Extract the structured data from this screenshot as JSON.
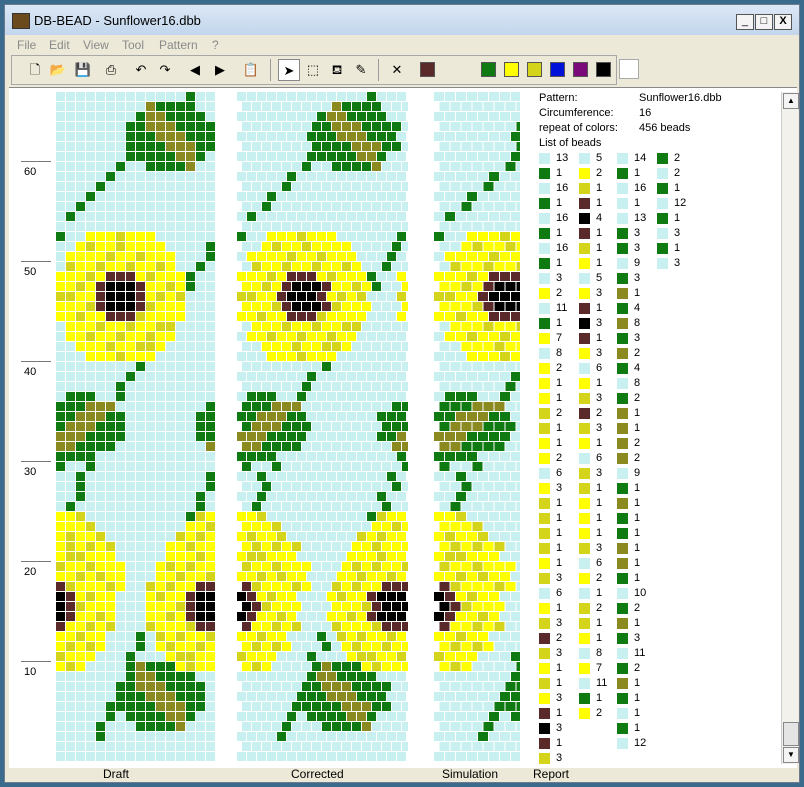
{
  "window": {
    "title": "DB-BEAD - Sunflower16.dbb",
    "buttons": {
      "minimize": "_",
      "maximize": "□",
      "close": "X"
    }
  },
  "menu": [
    "File",
    "Edit",
    "View",
    "Tool",
    "Pattern",
    "?"
  ],
  "toolbar": {
    "icons": [
      "new-icon",
      "open-icon",
      "save-icon",
      "print-icon",
      "undo-icon",
      "redo-icon",
      "arrow-left-icon",
      "arrow-right-icon",
      "paste-icon",
      "pointer-icon",
      "select-icon",
      "fill-icon",
      "pipette-icon",
      "delete-icon"
    ],
    "colors": [
      "#5a2a2a",
      "#0f7a12",
      "#ffff00",
      "#d4d41a",
      "#0012d8",
      "#7a0a7a",
      "#000000",
      "#ffffff"
    ]
  },
  "ruler": [
    "60",
    "50",
    "40",
    "30",
    "20",
    "10"
  ],
  "panel_labels": [
    "Draft",
    "Corrected",
    "Simulation",
    "Report"
  ],
  "report": {
    "pattern_label": "Pattern:",
    "pattern_value": "Sunflower16.dbb",
    "circ_label": "Circumference:",
    "circ_value": "16",
    "repeat_label": "repeat of colors:",
    "repeat_value": "456 beads",
    "list_label": "List of beads",
    "colors": {
      "L": "#c8f0f0",
      "G": "#0f7a12",
      "Y": "#ffff00",
      "K": "#d4d41a",
      "O": "#8a8a20",
      "B": "#5a2a2a",
      "X": "#000000"
    },
    "columns": [
      [
        [
          "L",
          "13"
        ],
        [
          "G",
          "1"
        ],
        [
          "L",
          "16"
        ],
        [
          "G",
          "1"
        ],
        [
          "L",
          "16"
        ],
        [
          "G",
          "1"
        ],
        [
          "L",
          "16"
        ],
        [
          "G",
          "1"
        ],
        [
          "L",
          "3"
        ],
        [
          "Y",
          "2"
        ],
        [
          "L",
          "11"
        ],
        [
          "G",
          "1"
        ],
        [
          "Y",
          "7"
        ],
        [
          "L",
          "8"
        ],
        [
          "Y",
          "2"
        ],
        [
          "Y",
          "1"
        ],
        [
          "Y",
          "1"
        ],
        [
          "K",
          "2"
        ],
        [
          "K",
          "1"
        ],
        [
          "Y",
          "1"
        ],
        [
          "Y",
          "2"
        ],
        [
          "L",
          "6"
        ],
        [
          "Y",
          "3"
        ],
        [
          "K",
          "1"
        ],
        [
          "K",
          "1"
        ],
        [
          "K",
          "1"
        ],
        [
          "K",
          "1"
        ],
        [
          "Y",
          "1"
        ],
        [
          "K",
          "3"
        ],
        [
          "L",
          "6"
        ],
        [
          "Y",
          "1"
        ],
        [
          "K",
          "3"
        ],
        [
          "B",
          "2"
        ],
        [
          "K",
          "3"
        ],
        [
          "Y",
          "1"
        ],
        [
          "K",
          "1"
        ],
        [
          "Y",
          "3"
        ],
        [
          "B",
          "1"
        ],
        [
          "X",
          "3"
        ],
        [
          "B",
          "1"
        ],
        [
          "K",
          "3"
        ]
      ],
      [
        [
          "L",
          "5"
        ],
        [
          "Y",
          "2"
        ],
        [
          "K",
          "1"
        ],
        [
          "B",
          "1"
        ],
        [
          "X",
          "4"
        ],
        [
          "B",
          "1"
        ],
        [
          "K",
          "1"
        ],
        [
          "Y",
          "1"
        ],
        [
          "L",
          "5"
        ],
        [
          "Y",
          "3"
        ],
        [
          "B",
          "1"
        ],
        [
          "X",
          "3"
        ],
        [
          "B",
          "1"
        ],
        [
          "Y",
          "3"
        ],
        [
          "L",
          "6"
        ],
        [
          "Y",
          "1"
        ],
        [
          "K",
          "3"
        ],
        [
          "B",
          "2"
        ],
        [
          "K",
          "3"
        ],
        [
          "Y",
          "1"
        ],
        [
          "L",
          "6"
        ],
        [
          "K",
          "3"
        ],
        [
          "K",
          "1"
        ],
        [
          "Y",
          "1"
        ],
        [
          "Y",
          "1"
        ],
        [
          "Y",
          "1"
        ],
        [
          "K",
          "3"
        ],
        [
          "L",
          "6"
        ],
        [
          "Y",
          "2"
        ],
        [
          "L",
          "1"
        ],
        [
          "K",
          "2"
        ],
        [
          "K",
          "1"
        ],
        [
          "Y",
          "1"
        ],
        [
          "L",
          "8"
        ],
        [
          "Y",
          "7"
        ],
        [
          "L",
          "11"
        ],
        [
          "G",
          "1"
        ],
        [
          "Y",
          "2"
        ]
      ],
      [
        [
          "L",
          "14"
        ],
        [
          "G",
          "1"
        ],
        [
          "L",
          "16"
        ],
        [
          "L",
          "1"
        ],
        [
          "L",
          "13"
        ],
        [
          "G",
          "3"
        ],
        [
          "G",
          "3"
        ],
        [
          "L",
          "9"
        ],
        [
          "G",
          "3"
        ],
        [
          "O",
          "1"
        ],
        [
          "G",
          "4"
        ],
        [
          "O",
          "8"
        ],
        [
          "G",
          "3"
        ],
        [
          "O",
          "2"
        ],
        [
          "G",
          "4"
        ],
        [
          "L",
          "8"
        ],
        [
          "G",
          "2"
        ],
        [
          "O",
          "1"
        ],
        [
          "O",
          "1"
        ],
        [
          "O",
          "2"
        ],
        [
          "O",
          "2"
        ],
        [
          "L",
          "9"
        ],
        [
          "G",
          "1"
        ],
        [
          "O",
          "1"
        ],
        [
          "G",
          "1"
        ],
        [
          "G",
          "1"
        ],
        [
          "O",
          "1"
        ],
        [
          "O",
          "1"
        ],
        [
          "G",
          "1"
        ],
        [
          "L",
          "10"
        ],
        [
          "G",
          "2"
        ],
        [
          "O",
          "1"
        ],
        [
          "G",
          "3"
        ],
        [
          "L",
          "11"
        ],
        [
          "G",
          "2"
        ],
        [
          "O",
          "1"
        ],
        [
          "G",
          "1"
        ],
        [
          "L",
          "1"
        ],
        [
          "G",
          "1"
        ],
        [
          "L",
          "12"
        ]
      ],
      [
        [
          "G",
          "2"
        ],
        [
          "L",
          "2"
        ],
        [
          "G",
          "1"
        ],
        [
          "L",
          "12"
        ],
        [
          "G",
          "1"
        ],
        [
          "L",
          "3"
        ],
        [
          "G",
          "1"
        ],
        [
          "L",
          "3"
        ]
      ]
    ]
  }
}
